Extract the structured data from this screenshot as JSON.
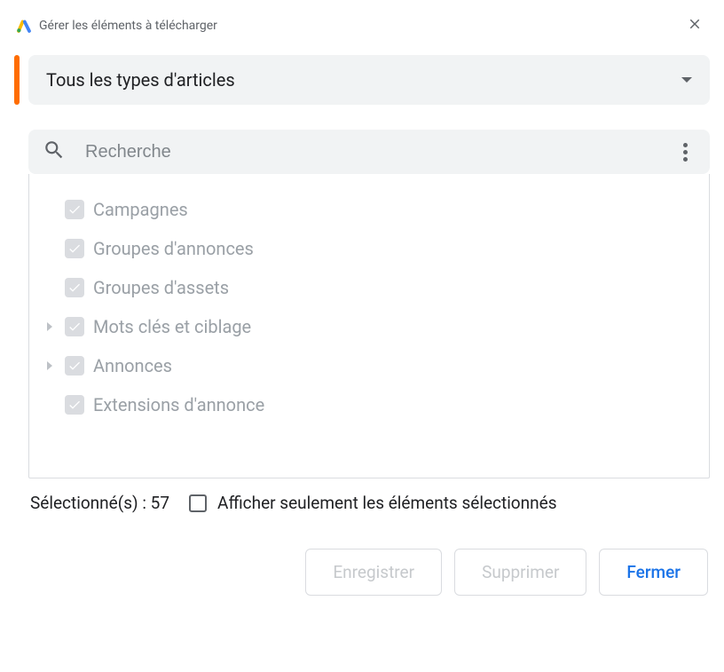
{
  "header": {
    "title": "Gérer les éléments à télécharger"
  },
  "dropdown": {
    "label": "Tous les types d'articles"
  },
  "search": {
    "placeholder": "Recherche"
  },
  "tree": {
    "items": [
      {
        "label": "Campagnes",
        "expandable": false
      },
      {
        "label": "Groupes d'annonces",
        "expandable": false
      },
      {
        "label": "Groupes d'assets",
        "expandable": false
      },
      {
        "label": "Mots clés et ciblage",
        "expandable": true
      },
      {
        "label": "Annonces",
        "expandable": true
      },
      {
        "label": "Extensions d'annonce",
        "expandable": false
      }
    ]
  },
  "status": {
    "selected_label": "Sélectionné(s) : 57",
    "show_only_selected": "Afficher seulement les éléments sélectionnés"
  },
  "buttons": {
    "save": "Enregistrer",
    "delete": "Supprimer",
    "close": "Fermer"
  }
}
